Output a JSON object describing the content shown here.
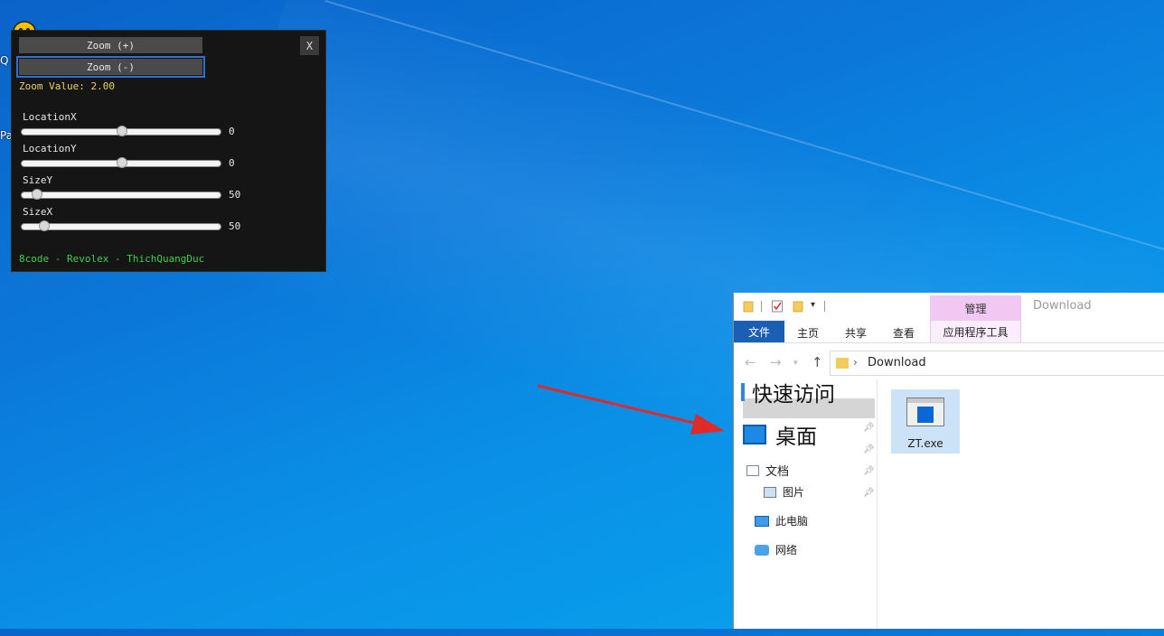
{
  "desktop": {
    "label_fragment_1": "Q",
    "label_fragment_2": "Pal"
  },
  "tool_window": {
    "close_label": "X",
    "zoom_in_label": "Zoom (+)",
    "zoom_out_label": "Zoom (-)",
    "zoom_value_text": "Zoom Value:  2.00",
    "sliders": [
      {
        "label": "LocationX",
        "value": "0",
        "level": 0.5
      },
      {
        "label": "LocationY",
        "value": "0",
        "level": 0.5
      },
      {
        "label": "SizeY",
        "value": "50",
        "level": 0.05
      },
      {
        "label": "SizeX",
        "value": "50",
        "level": 0.09
      }
    ],
    "credit": "8code - Revolex - ThichQuangDuc",
    "colors": {
      "zoom_value": "#e8d46a",
      "credit": "#3fcf4a",
      "focus": "#2f6fd0"
    }
  },
  "explorer": {
    "title": "Download",
    "manage_tab": "管理",
    "app_tools_tab": "应用程序工具",
    "ribbon_tabs": [
      "文件",
      "主页",
      "共享",
      "查看"
    ],
    "address_path": "Download",
    "nav": {
      "quick_access": "快速访问",
      "desktop": "桌面",
      "documents": "文档",
      "pictures": "图片",
      "this_pc": "此电脑",
      "network": "网络"
    },
    "files": [
      {
        "name": "ZT.exe",
        "icon": "exe-window-icon"
      }
    ],
    "colors": {
      "file_tab": "#1a5fb4",
      "manage_tab": "#f0c8f2",
      "selection": "#cce2f7"
    }
  }
}
